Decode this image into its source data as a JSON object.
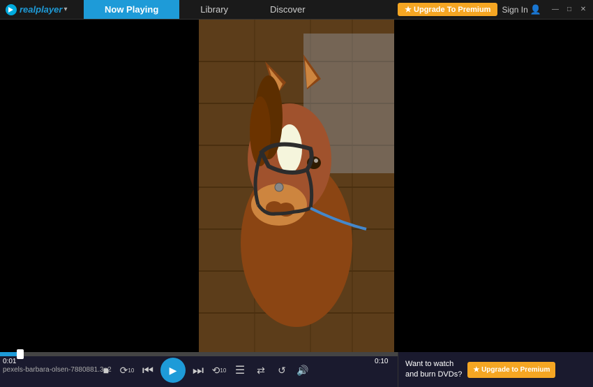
{
  "titlebar": {
    "logo_text": "realplayer",
    "logo_dropdown": "▾"
  },
  "nav": {
    "tabs": [
      {
        "id": "now-playing",
        "label": "Now Playing",
        "active": true
      },
      {
        "id": "library",
        "label": "Library",
        "active": false
      },
      {
        "id": "discover",
        "label": "Discover",
        "active": false
      }
    ]
  },
  "header": {
    "upgrade_label": "★ Upgrade To Premium",
    "signin_label": "Sign In"
  },
  "window_controls": {
    "minimize": "—",
    "maximize": "□",
    "close": "✕"
  },
  "player": {
    "filename": "pexels-barbara-olsen-7880881.3g2",
    "time_current": "0:01",
    "time_total": "0:10",
    "progress_percent": 5
  },
  "controls": {
    "stop": "■",
    "rewind10": "↺",
    "prev": "⏮",
    "play": "▶",
    "next": "⏭",
    "forward": "↻",
    "playlist": "☰",
    "shuffle": "⇄",
    "repeat": "↺",
    "volume": "🔊"
  },
  "cta": {
    "text": "Want to watch\nand burn DVDs?",
    "button_label": "★ Upgrade to Premium"
  }
}
